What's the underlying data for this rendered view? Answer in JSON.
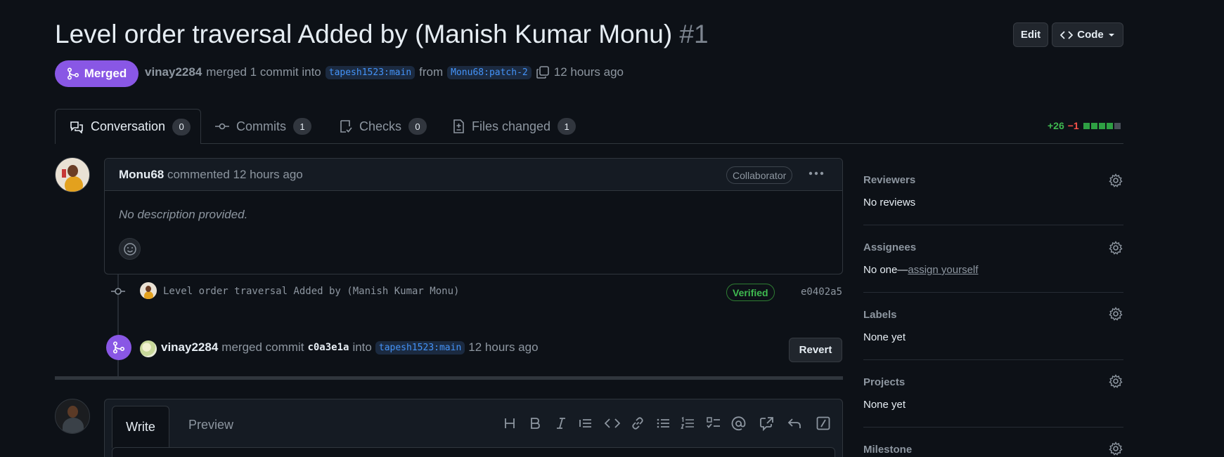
{
  "pr": {
    "title": "Level order traversal Added by (Manish Kumar Monu)",
    "number": "#1",
    "state_label": "Merged",
    "author": "vinay2284",
    "merge_text": "merged 1 commit into",
    "base_branch": "tapesh1523:main",
    "from_text": "from",
    "head_branch": "Monu68:patch-2",
    "time": "12 hours ago"
  },
  "header_actions": {
    "edit_label": "Edit",
    "code_label": "Code"
  },
  "tabs": [
    {
      "label": "Conversation",
      "count": "0"
    },
    {
      "label": "Commits",
      "count": "1"
    },
    {
      "label": "Checks",
      "count": "0"
    },
    {
      "label": "Files changed",
      "count": "1"
    }
  ],
  "diffstat": {
    "additions": "+26",
    "deletions": "−1"
  },
  "comment": {
    "author": "Monu68",
    "meta": "commented 12 hours ago",
    "badge": "Collaborator",
    "body": "No description provided."
  },
  "commit": {
    "message": "Level order traversal Added by (Manish Kumar Monu)",
    "verified": "Verified",
    "sha": "e0402a5"
  },
  "merge_event": {
    "actor": "vinay2284",
    "text1": "merged commit",
    "sha": "c0a3e1a",
    "text2": "into",
    "branch": "tapesh1523:main",
    "time": "12 hours ago",
    "revert_label": "Revert"
  },
  "composer": {
    "write_tab": "Write",
    "preview_tab": "Preview"
  },
  "sidebar": {
    "reviewers": {
      "heading": "Reviewers",
      "value": "No reviews"
    },
    "assignees": {
      "heading": "Assignees",
      "value": "No one—",
      "link": "assign yourself"
    },
    "labels": {
      "heading": "Labels",
      "value": "None yet"
    },
    "projects": {
      "heading": "Projects",
      "value": "None yet"
    },
    "milestone": {
      "heading": "Milestone"
    }
  },
  "colors": {
    "merged": "#8957e5",
    "green": "#3fb950",
    "red": "#f85149",
    "link": "#4493f8",
    "bg": "#0d1117"
  }
}
